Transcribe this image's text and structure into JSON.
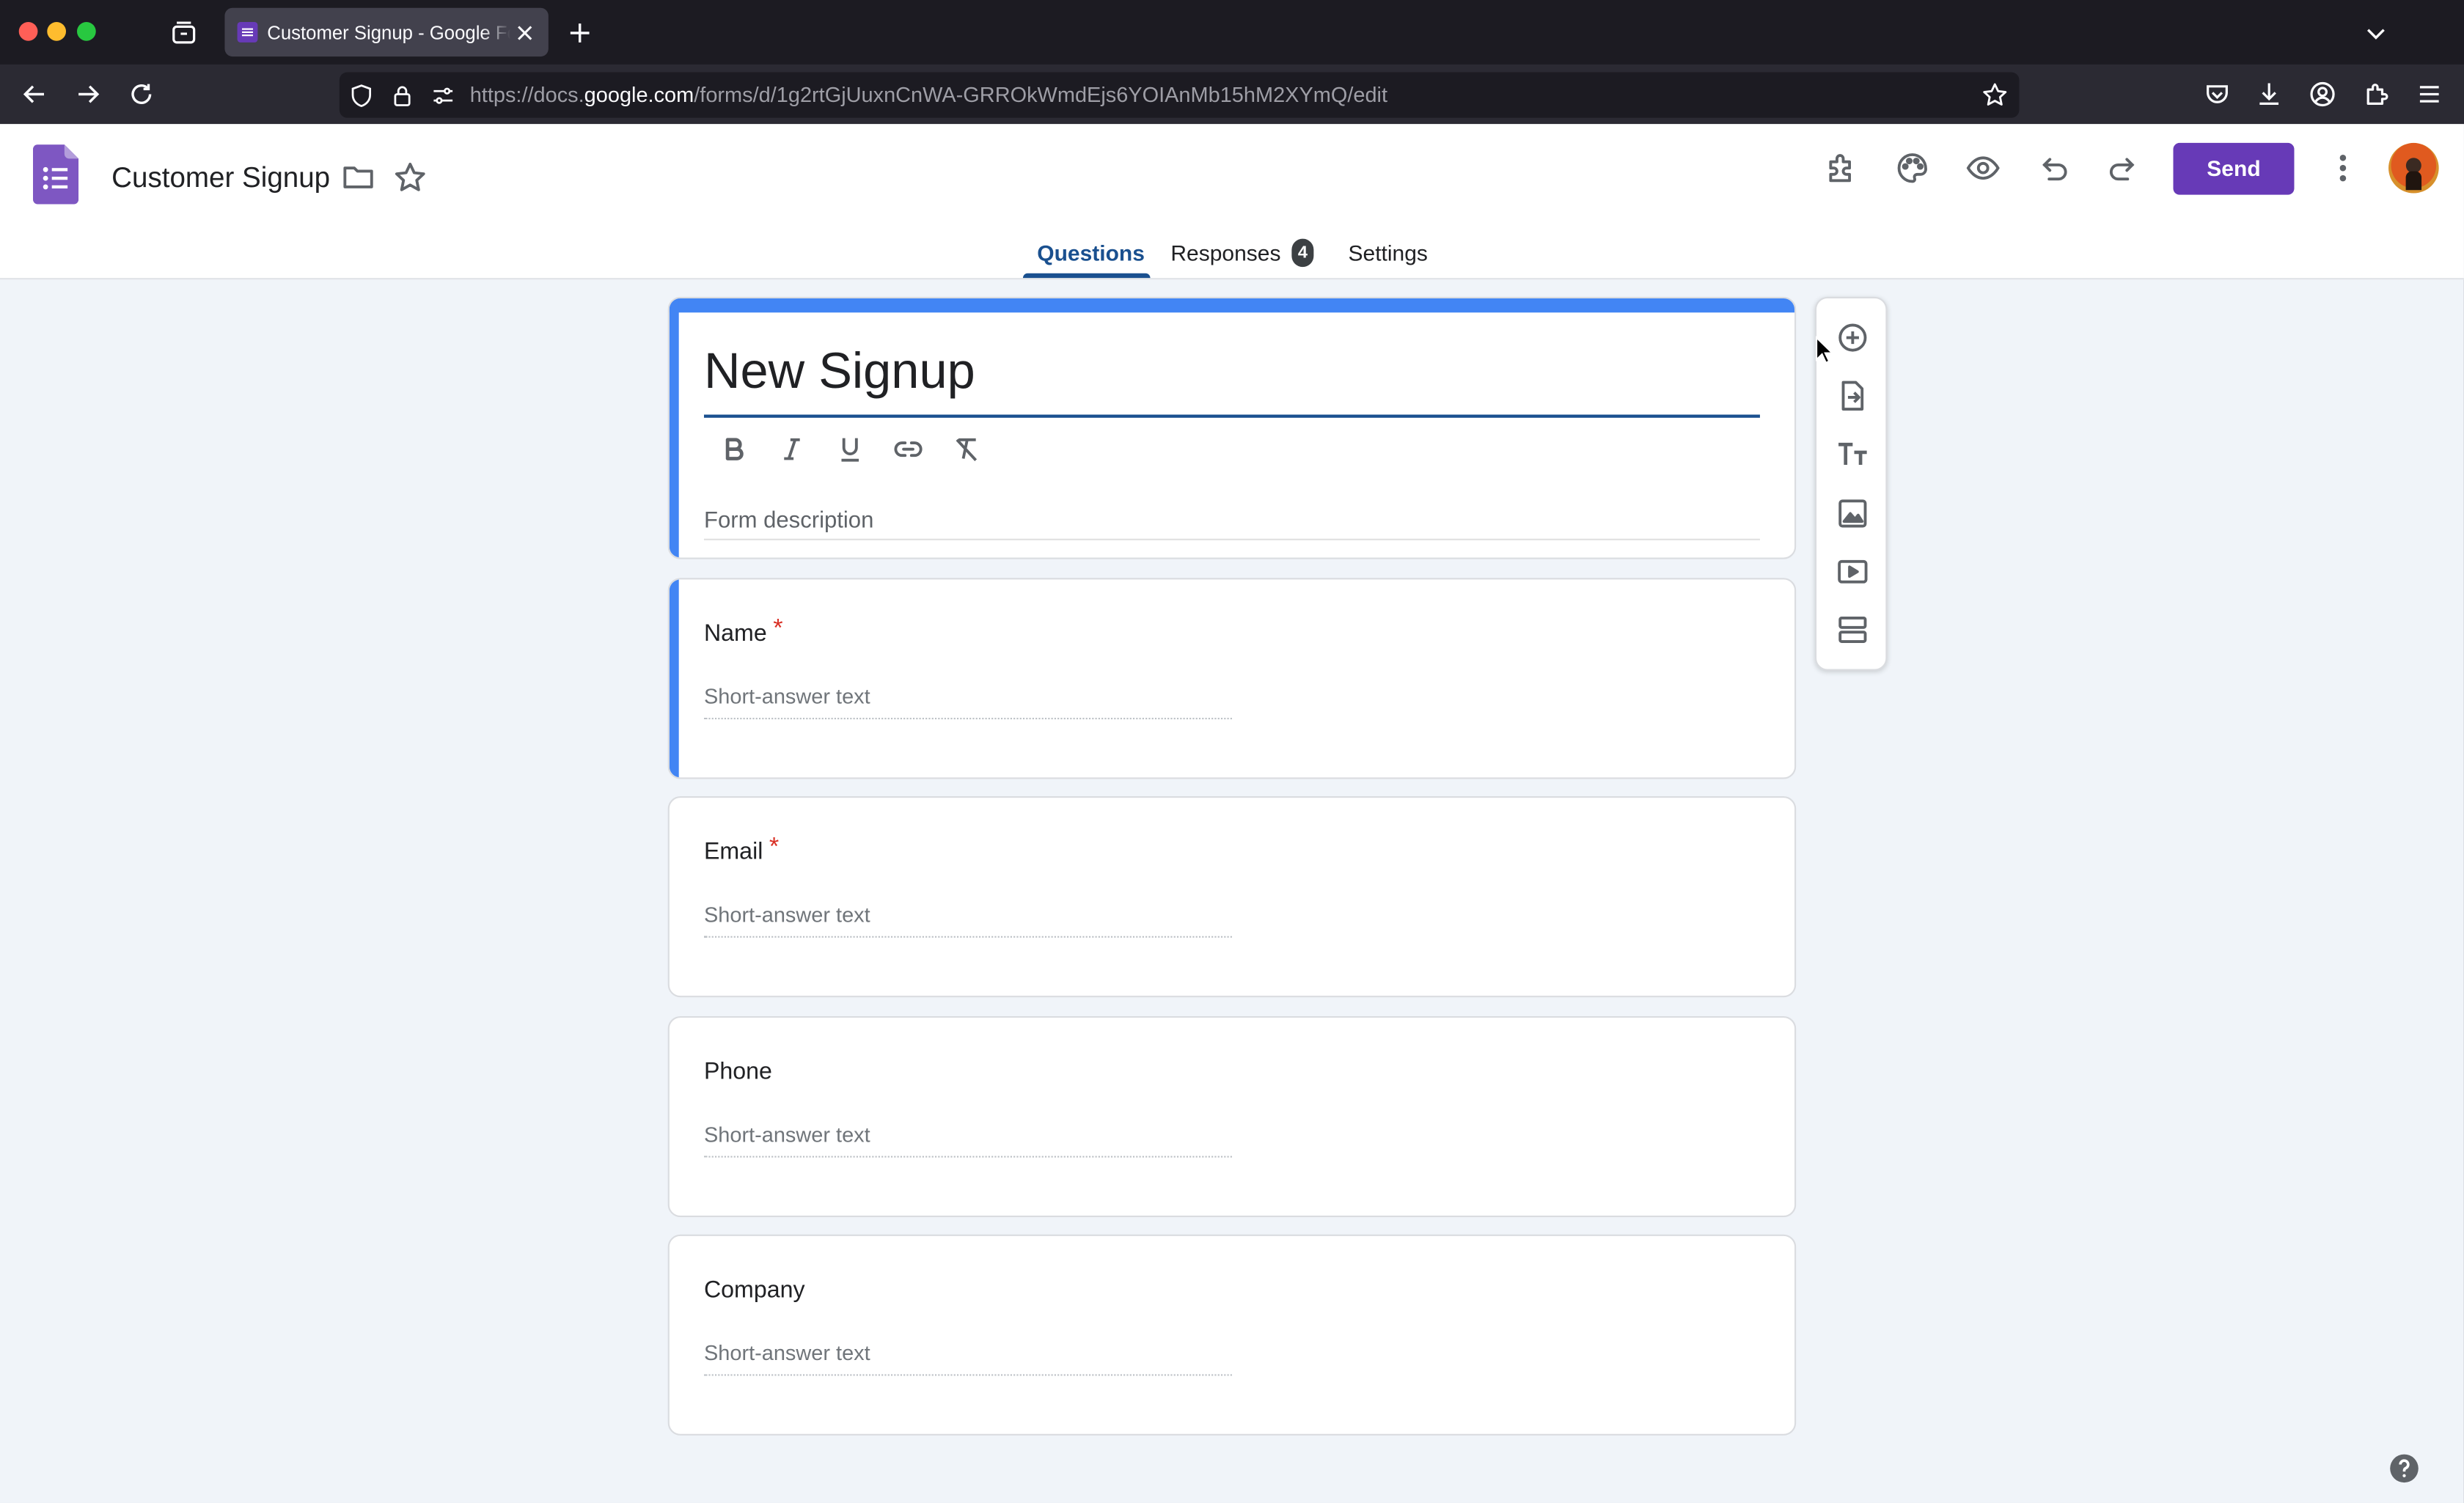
{
  "browser": {
    "tab_title": "Customer Signup - Google Forms",
    "url_prefix": "https://docs.",
    "url_host": "google.com",
    "url_path": "/forms/d/1g2rtGjUuxnCnWA-GRROkWmdEjs6YOIAnMb15hM2XYmQ/edit"
  },
  "header": {
    "form_name": "Customer Signup",
    "send_label": "Send"
  },
  "tabs": {
    "questions": "Questions",
    "responses": "Responses",
    "responses_count": "4",
    "settings": "Settings"
  },
  "form": {
    "title": "New Signup",
    "description_placeholder": "Form description",
    "questions": [
      {
        "title": "Name",
        "required_mark": "*",
        "placeholder": "Short-answer text"
      },
      {
        "title": "Email",
        "required_mark": "*",
        "placeholder": "Short-answer text"
      },
      {
        "title": "Phone",
        "required_mark": "",
        "placeholder": "Short-answer text"
      },
      {
        "title": "Company",
        "required_mark": "",
        "placeholder": "Short-answer text"
      }
    ]
  },
  "icons": {
    "side_toolbar": [
      "add-question-icon",
      "import-questions-icon",
      "add-title-icon",
      "add-image-icon",
      "add-video-icon",
      "add-section-icon"
    ],
    "format_toolbar": [
      "bold-icon",
      "italic-icon",
      "underline-icon",
      "link-icon",
      "clear-formatting-icon"
    ]
  },
  "colors": {
    "accent": "#673ab7",
    "theme_blue": "#4285f4",
    "tab_active": "#1a508f",
    "background": "#f0f4f9",
    "required": "#d93025"
  }
}
